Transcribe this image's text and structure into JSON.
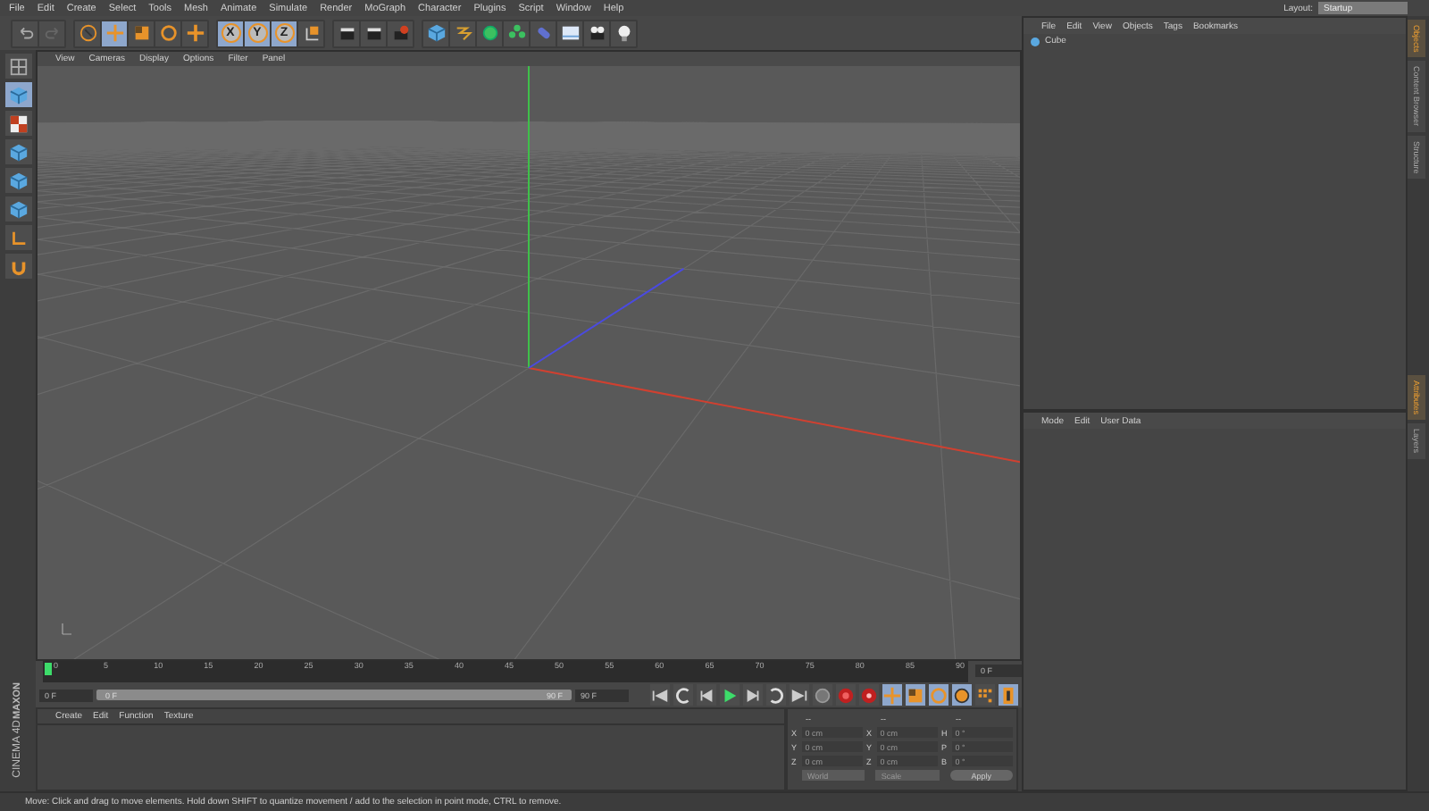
{
  "menu_bar": {
    "items": [
      "File",
      "Edit",
      "Create",
      "Select",
      "Tools",
      "Mesh",
      "Animate",
      "Simulate",
      "Render",
      "MoGraph",
      "Character",
      "Plugins",
      "Script",
      "Window",
      "Help"
    ],
    "layout_label": "Layout:",
    "layout_value": "Startup"
  },
  "toolbar": {
    "groups": [
      [
        {
          "kind": "undo",
          "active": false
        },
        {
          "kind": "redo",
          "active": false
        }
      ],
      [
        {
          "kind": "live-select",
          "active": false
        },
        {
          "kind": "move",
          "active": true
        },
        {
          "kind": "scale",
          "active": false
        },
        {
          "kind": "rotate",
          "active": false
        },
        {
          "kind": "add",
          "active": false
        }
      ],
      [
        {
          "kind": "axis",
          "label": "X",
          "active": true
        },
        {
          "kind": "axis",
          "label": "Y",
          "active": true
        },
        {
          "kind": "axis",
          "label": "Z",
          "active": true
        },
        {
          "kind": "coordinates",
          "active": false
        }
      ],
      [
        {
          "kind": "clapper",
          "active": false
        },
        {
          "kind": "clapper",
          "active": false
        },
        {
          "kind": "clapper-gear",
          "active": false
        }
      ],
      [
        {
          "kind": "cube",
          "active": false
        },
        {
          "kind": "pen",
          "active": false
        },
        {
          "kind": "sphere",
          "active": false
        },
        {
          "kind": "flower",
          "active": false
        },
        {
          "kind": "capsule",
          "active": false
        },
        {
          "kind": "floor",
          "active": false
        },
        {
          "kind": "camera",
          "active": false
        },
        {
          "kind": "bulb",
          "active": false
        }
      ]
    ]
  },
  "left_tools": [
    {
      "kind": "layout",
      "active": false
    },
    {
      "kind": "cube",
      "active": true
    },
    {
      "kind": "checker",
      "active": false
    },
    {
      "kind": "cube",
      "active": false
    },
    {
      "kind": "cube",
      "active": false
    },
    {
      "kind": "cube",
      "active": false
    },
    {
      "kind": "axis-corner",
      "active": false
    },
    {
      "kind": "magnet",
      "active": false
    }
  ],
  "viewport": {
    "menu": [
      "View",
      "Cameras",
      "Display",
      "Options",
      "Filter",
      "Panel"
    ]
  },
  "objects_panel": {
    "menu": [
      "File",
      "Edit",
      "View",
      "Objects",
      "Tags",
      "Bookmarks"
    ],
    "objects": [
      {
        "name": "Cube",
        "selected": false
      }
    ]
  },
  "attributes_panel": {
    "menu": [
      "Mode",
      "Edit",
      "User Data"
    ]
  },
  "side_tabs_top": [
    {
      "label": "Objects",
      "selected": true
    },
    {
      "label": "Content Browser",
      "selected": false
    },
    {
      "label": "Structure",
      "selected": false
    }
  ],
  "side_tabs_bottom": [
    {
      "label": "Attributes",
      "selected": true
    },
    {
      "label": "Layers",
      "selected": false
    }
  ],
  "timeline": {
    "ticks": [
      "0",
      "5",
      "10",
      "15",
      "20",
      "25",
      "30",
      "35",
      "40",
      "45",
      "50",
      "55",
      "60",
      "65",
      "70",
      "75",
      "80",
      "85",
      "90"
    ],
    "current_frame": "0 F",
    "start_field": "0 F",
    "range_start": "0 F",
    "range_end": "90 F",
    "end_field": "90 F",
    "playhead": {
      "level": 0
    },
    "range": {
      "level": 1
    }
  },
  "transport": [
    {
      "kind": "to-start",
      "active": false
    },
    {
      "kind": "prev-key",
      "active": false
    },
    {
      "kind": "prev-frame",
      "active": false
    },
    {
      "kind": "play",
      "active": false
    },
    {
      "kind": "next-frame",
      "active": false
    },
    {
      "kind": "next-key",
      "active": false
    },
    {
      "kind": "to-end",
      "active": false
    },
    {
      "kind": "key-grey",
      "active": false
    },
    {
      "kind": "record",
      "active": false
    },
    {
      "kind": "auto-key",
      "active": false
    },
    {
      "kind": "move",
      "active": true
    },
    {
      "kind": "scale",
      "active": true
    },
    {
      "kind": "rotate",
      "active": true
    },
    {
      "kind": "param",
      "active": true
    },
    {
      "kind": "grid",
      "active": false
    },
    {
      "kind": "film",
      "active": true
    }
  ],
  "material_panel": {
    "menu": [
      "Create",
      "Edit",
      "Function",
      "Texture"
    ]
  },
  "logo": {
    "brand": "MAXON",
    "product": "CINEMA 4D"
  },
  "coordinates": {
    "headers": [
      "--",
      "--",
      "--"
    ],
    "rows": [
      [
        {
          "axis": "X",
          "value": "0 cm"
        },
        {
          "axis": "X",
          "value": "0 cm"
        },
        {
          "axis": "H",
          "value": "0 °"
        }
      ],
      [
        {
          "axis": "Y",
          "value": "0 cm"
        },
        {
          "axis": "Y",
          "value": "0 cm"
        },
        {
          "axis": "P",
          "value": "0 °"
        }
      ],
      [
        {
          "axis": "Z",
          "value": "0 cm"
        },
        {
          "axis": "Z",
          "value": "0 cm"
        },
        {
          "axis": "B",
          "value": "0 °"
        }
      ]
    ],
    "mode": "World",
    "size_mode": "Scale",
    "apply": "Apply"
  },
  "status_bar": {
    "text": "Move: Click and drag to move elements. Hold down SHIFT to quantize movement / add to the selection in point mode, CTRL to remove."
  }
}
